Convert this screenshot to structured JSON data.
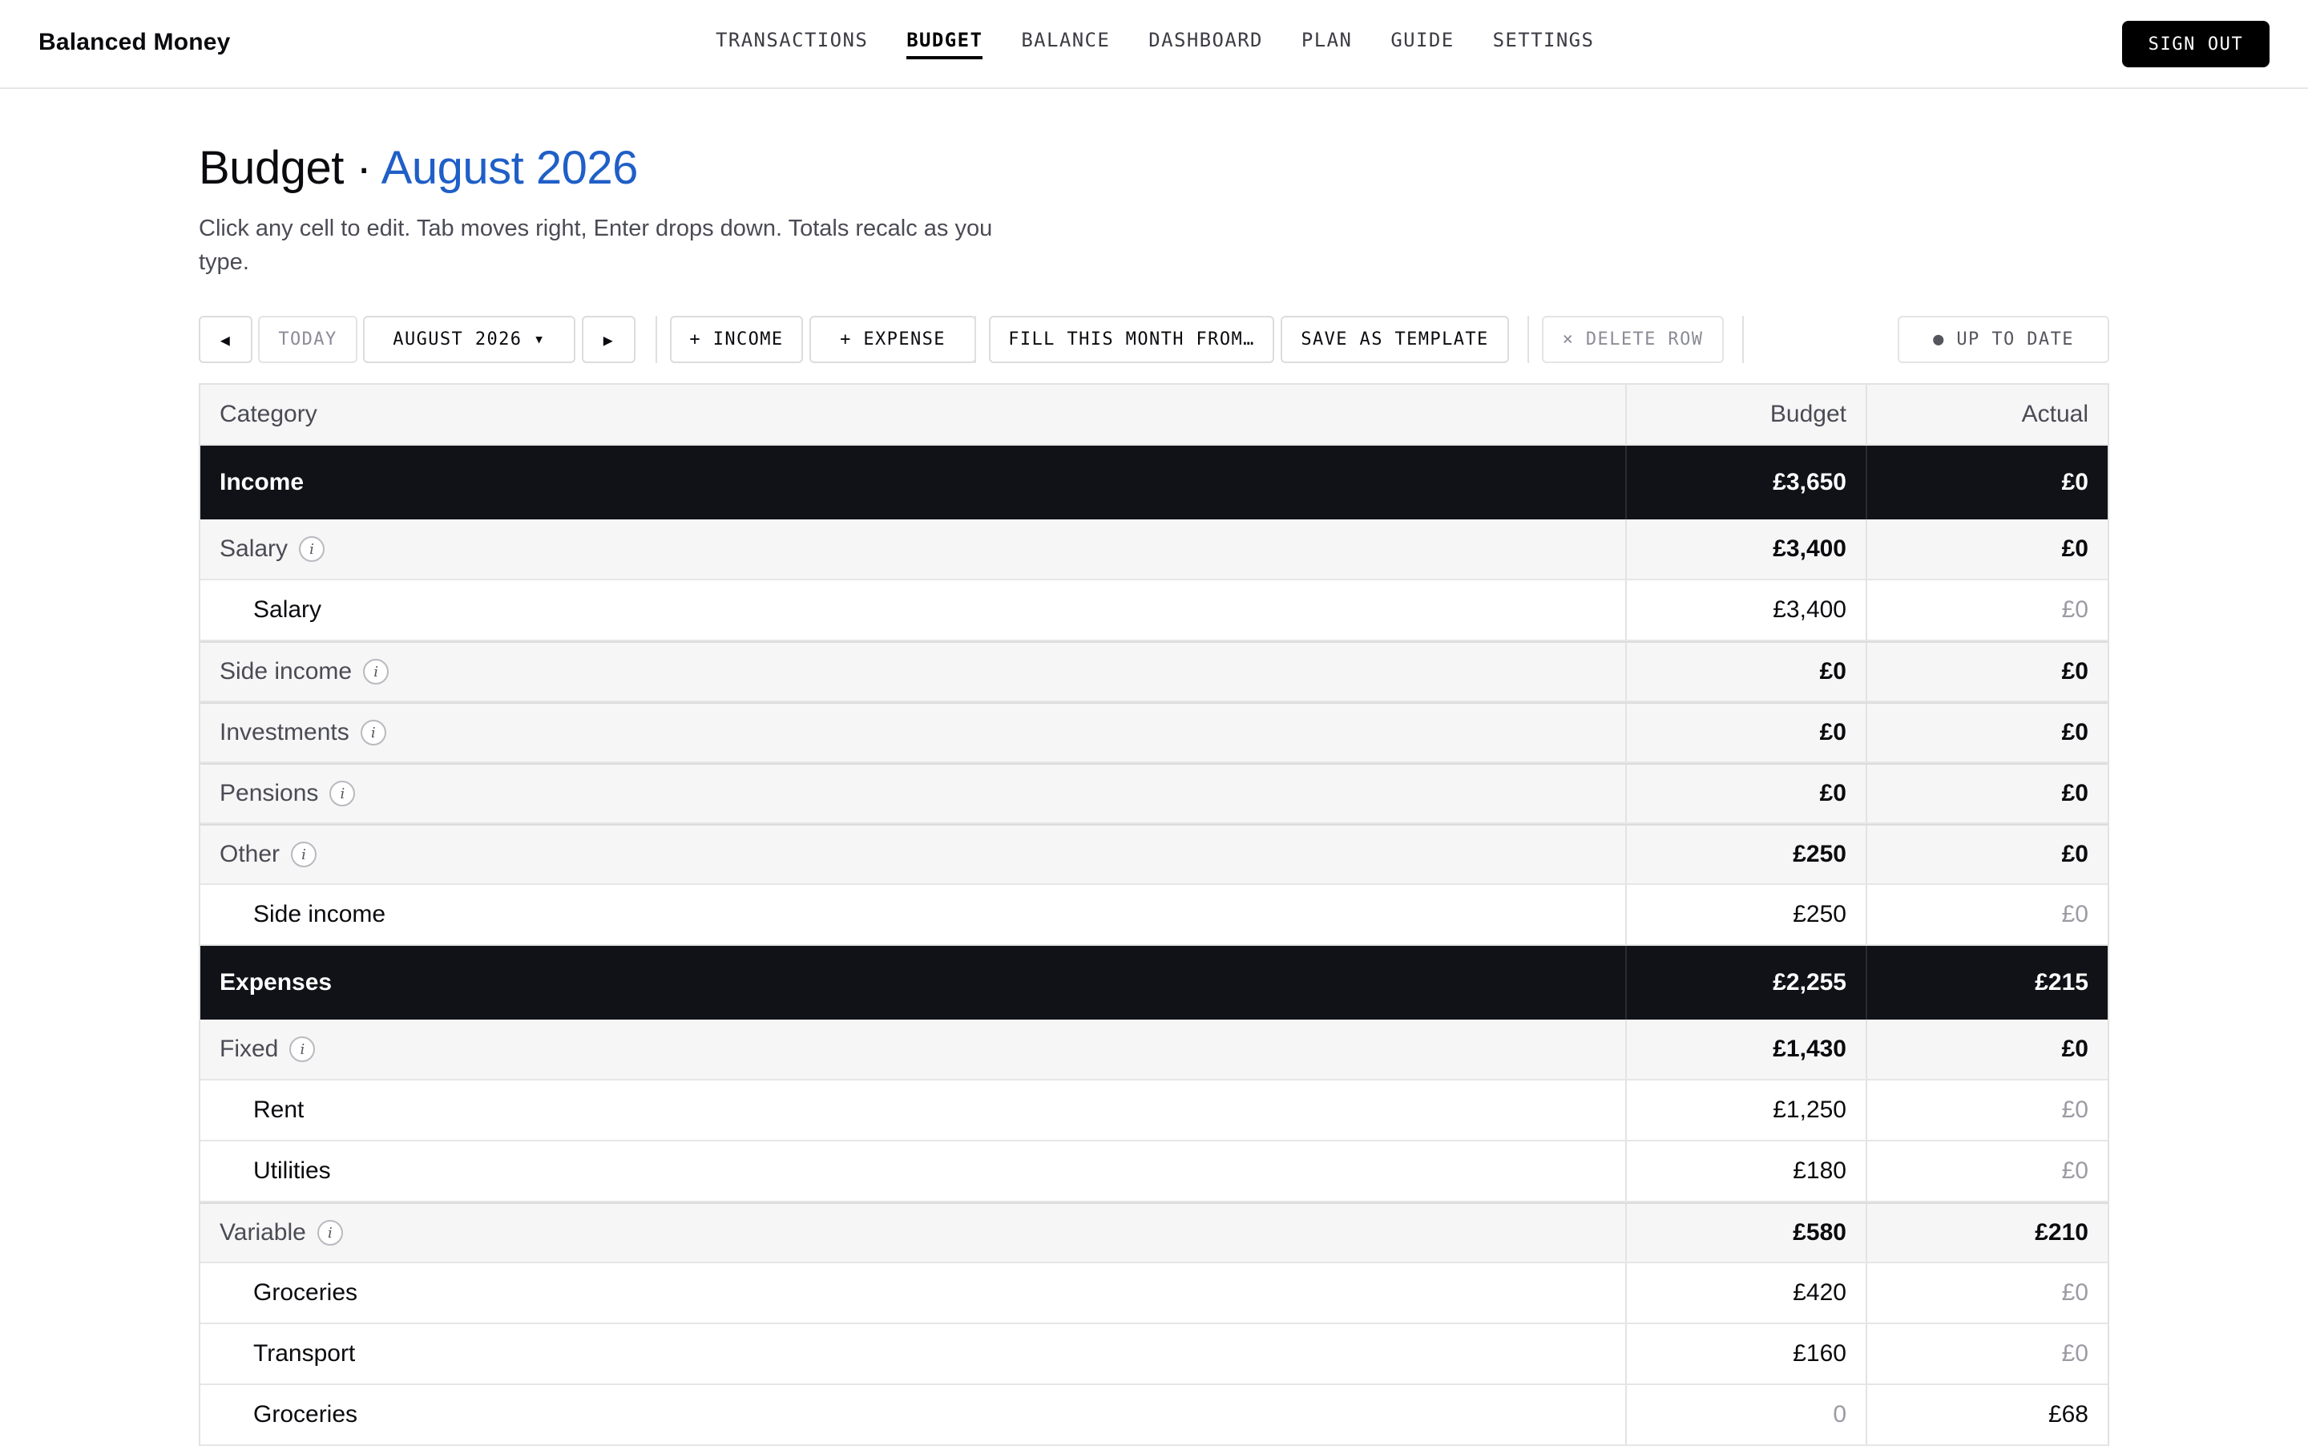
{
  "app": {
    "brand": "Balanced Money",
    "nav": [
      "TRANSACTIONS",
      "BUDGET",
      "BALANCE",
      "DASHBOARD",
      "PLAN",
      "GUIDE",
      "SETTINGS"
    ],
    "active_nav": "BUDGET",
    "sign_out": "SIGN OUT"
  },
  "page": {
    "title_prefix": "Budget · ",
    "title_month": "August 2026",
    "subtitle": "Click any cell to edit. Tab moves right, Enter drops down. Totals recalc as you type."
  },
  "toolbar": {
    "prev": "◀",
    "today": "TODAY",
    "month_select": "AUGUST 2026 ▾",
    "next": "▶",
    "add_income": "+ INCOME",
    "add_expense": "+ EXPENSE",
    "fill_month": "FILL THIS MONTH FROM…",
    "save_template": "SAVE AS TEMPLATE",
    "delete_row": "× DELETE ROW",
    "status": "● UP TO DATE"
  },
  "table": {
    "columns": [
      "Category",
      "Budget",
      "Actual"
    ],
    "rows": [
      {
        "kind": "section",
        "label": "Income",
        "budget": "£3,650",
        "actual": "£0"
      },
      {
        "kind": "group",
        "label": "Salary",
        "budget": "£3,400",
        "actual": "£0"
      },
      {
        "kind": "item",
        "label": "Salary",
        "budget": "£3,400",
        "actual": "£0"
      },
      {
        "kind": "group",
        "label": "Side income",
        "budget": "£0",
        "actual": "£0"
      },
      {
        "kind": "group",
        "label": "Investments",
        "budget": "£0",
        "actual": "£0"
      },
      {
        "kind": "group",
        "label": "Pensions",
        "budget": "£0",
        "actual": "£0"
      },
      {
        "kind": "group",
        "label": "Other",
        "budget": "£250",
        "actual": "£0"
      },
      {
        "kind": "item",
        "label": "Side income",
        "budget": "£250",
        "actual": "£0"
      },
      {
        "kind": "section",
        "label": "Expenses",
        "budget": "£2,255",
        "actual": "£215"
      },
      {
        "kind": "group",
        "label": "Fixed",
        "budget": "£1,430",
        "actual": "£0"
      },
      {
        "kind": "item",
        "label": "Rent",
        "budget": "£1,250",
        "actual": "£0"
      },
      {
        "kind": "item",
        "label": "Utilities",
        "budget": "£180",
        "actual": "£0"
      },
      {
        "kind": "group",
        "label": "Variable",
        "budget": "£580",
        "actual": "£210"
      },
      {
        "kind": "item",
        "label": "Groceries",
        "budget": "£420",
        "actual": "£0"
      },
      {
        "kind": "item",
        "label": "Transport",
        "budget": "£160",
        "actual": "£0"
      },
      {
        "kind": "item",
        "label": "Groceries",
        "budget": "0",
        "actual": "£68"
      }
    ]
  },
  "icons": {
    "info": "i"
  },
  "colors": {
    "accent": "#1f5fc7",
    "section_bg": "#111217",
    "group_bg": "#f6f6f6"
  }
}
